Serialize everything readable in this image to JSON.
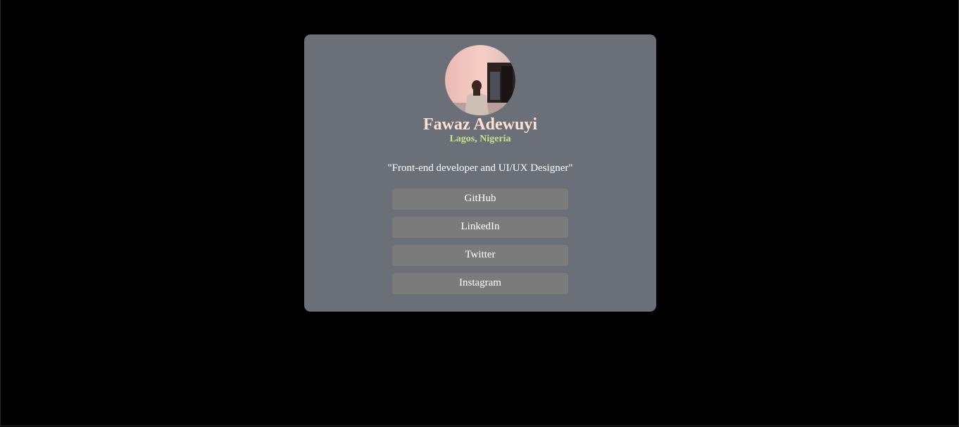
{
  "profile": {
    "name": "Fawaz Adewuyi",
    "location": "Lagos, Nigeria",
    "bio": "\"Front-end developer and UI/UX Designer\"",
    "avatar_icon": "profile-photo"
  },
  "links": [
    {
      "label": "GitHub"
    },
    {
      "label": "LinkedIn"
    },
    {
      "label": "Twitter"
    },
    {
      "label": "Instagram"
    }
  ],
  "colors": {
    "page_background": "#000000",
    "card_background": "#6b6f78",
    "button_background": "#7b7b7b",
    "name_color": "#fde2d2",
    "location_color": "#c6e28a",
    "text_color": "#ffffff"
  }
}
